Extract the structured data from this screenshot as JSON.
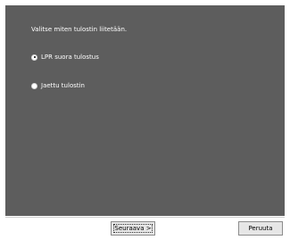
{
  "dialog": {
    "prompt": "Valitse miten tulostin liitetään.",
    "options": [
      {
        "label": "LPR suora tulostus",
        "selected": true
      },
      {
        "label": "Jaettu tulostin",
        "selected": false
      }
    ]
  },
  "footer": {
    "next_label": "Seuraava >",
    "cancel_label": "Peruuta"
  }
}
